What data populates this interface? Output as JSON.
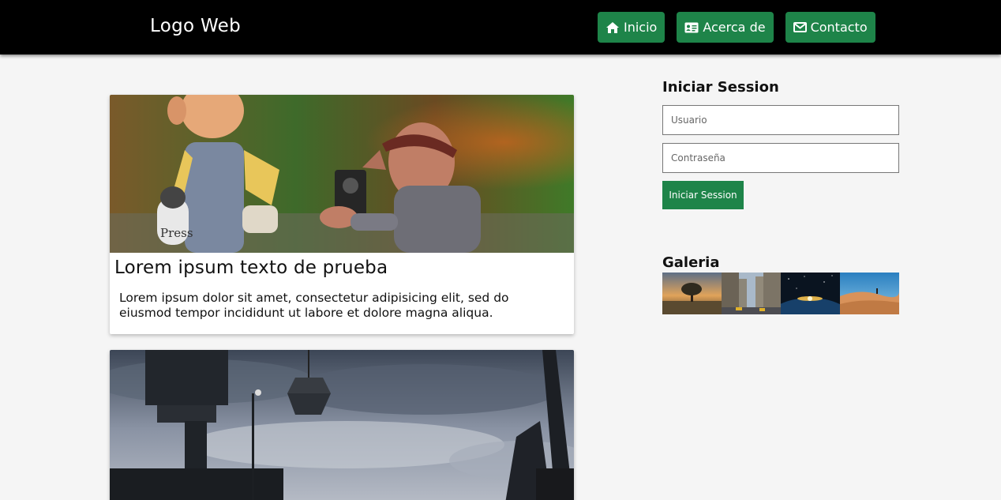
{
  "header": {
    "logo": "Logo Web",
    "nav": [
      {
        "label": "Inicio",
        "icon": "home-icon"
      },
      {
        "label": "Acerca de",
        "icon": "id-card-icon"
      },
      {
        "label": "Contacto",
        "icon": "envelope-icon"
      }
    ]
  },
  "posts": [
    {
      "title": "Lorem ipsum texto de prueba",
      "body": "Lorem ipsum dolor sit amet, consectetur adipisicing elit, sed do eiusmod tempor incididunt ut labore et dolore magna aliqua.",
      "image": "press-photographer-figurines-image"
    },
    {
      "image": "industrial-cranes-cloudy-sky-image"
    }
  ],
  "sidebar": {
    "login": {
      "title": "Iniciar Session",
      "username_placeholder": "Usuario",
      "password_placeholder": "Contraseña",
      "submit_label": "Iniciar Session"
    },
    "gallery": {
      "title": "Galeria",
      "thumbnails": [
        "tree-sunset-thumbnail",
        "city-street-thumbnail",
        "earth-space-thumbnail",
        "desert-dune-thumbnail"
      ]
    }
  },
  "colors": {
    "header_bg": "#000000",
    "accent": "#1e8449",
    "page_bg": "#f5f5f5"
  }
}
